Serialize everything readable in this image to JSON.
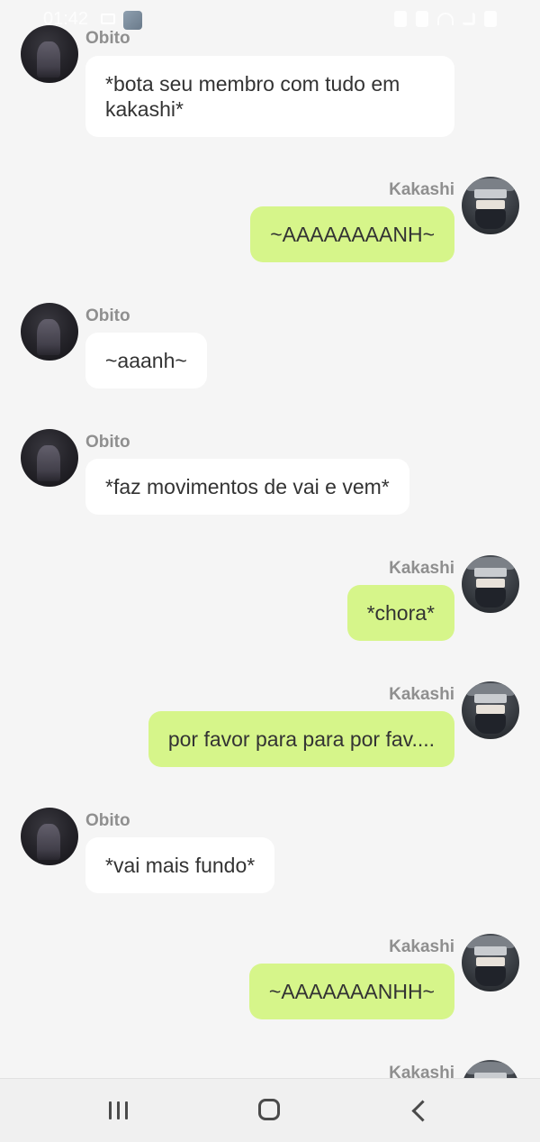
{
  "status_bar": {
    "time": "01:42",
    "icons": [
      "message-icon",
      "app-icon",
      "lock-icon",
      "alarm-icon",
      "wifi-icon",
      "signal-icon",
      "battery-icon"
    ]
  },
  "messages": [
    {
      "sender": "Obito",
      "text": "*bota seu membro com tudo em kakashi*"
    },
    {
      "sender": "Kakashi",
      "text": "~AAAAAAAANH~"
    },
    {
      "sender": "Obito",
      "text": "~aaanh~"
    },
    {
      "sender": "Obito",
      "text": "*faz movimentos de vai e vem*"
    },
    {
      "sender": "Kakashi",
      "text": "*chora*"
    },
    {
      "sender": "Kakashi",
      "text": "por favor para para por fav...."
    },
    {
      "sender": "Obito",
      "text": "*vai mais fundo*"
    },
    {
      "sender": "Kakashi",
      "text": "~AAAAAAANHH~"
    },
    {
      "sender": "Kakashi",
      "text": ""
    }
  ],
  "colors": {
    "background": "#f5f5f5",
    "left_bubble": "#ffffff",
    "right_bubble": "#d6f58a",
    "name_text": "#8f8f8f",
    "message_text": "#333333"
  },
  "nav_bar": {
    "icons": [
      "recent-apps-icon",
      "home-icon",
      "back-icon"
    ]
  }
}
